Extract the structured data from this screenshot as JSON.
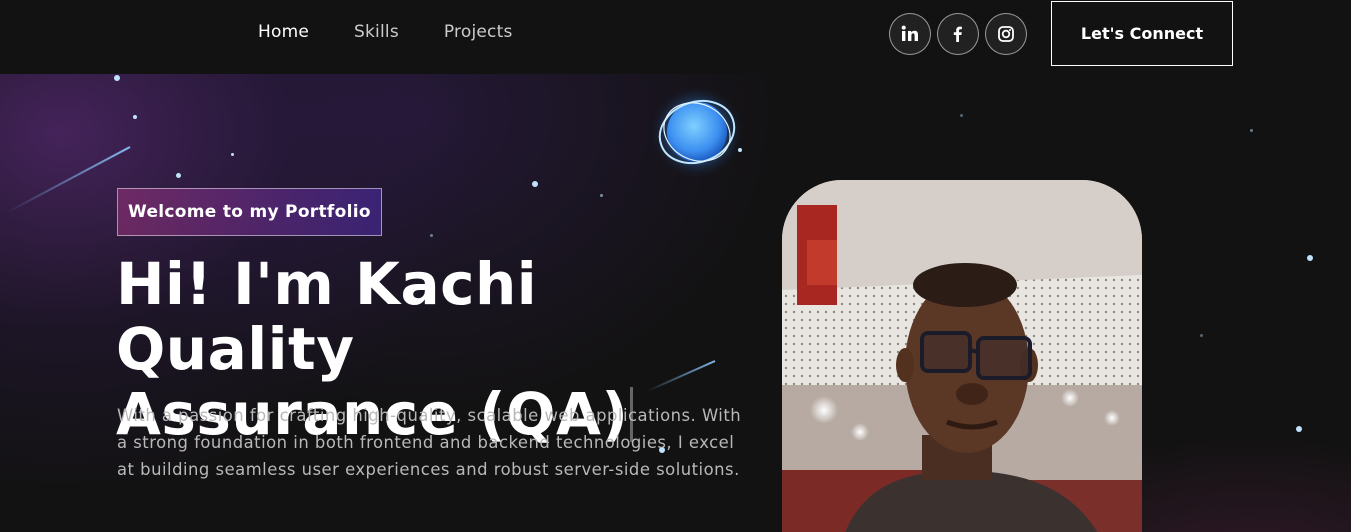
{
  "nav": {
    "links": [
      {
        "label": "Home",
        "active": true
      },
      {
        "label": "Skills",
        "active": false
      },
      {
        "label": "Projects",
        "active": false
      }
    ],
    "social": [
      {
        "icon": "linkedin-icon",
        "glyph": "in"
      },
      {
        "icon": "facebook-icon",
        "glyph": "f"
      },
      {
        "icon": "instagram-icon",
        "glyph": ""
      }
    ],
    "connect_label": "Let's Connect"
  },
  "banner": {
    "tagline": "Welcome to my Portfolio",
    "headline_line1": "Hi! I'm Kachi Quality",
    "headline_line2": "Assurance (QA)",
    "bio": "With a passion for crafting high-quality, scalable web applications. With a strong foundation in both frontend and backend technologies, I excel at building seamless user experiences and robust server-side solutions."
  },
  "colors": {
    "background": "#121212",
    "tagline_gradient_start": "#AA367C",
    "tagline_gradient_end": "#4A2FBD",
    "planet_glow": "#4aa3ff"
  }
}
